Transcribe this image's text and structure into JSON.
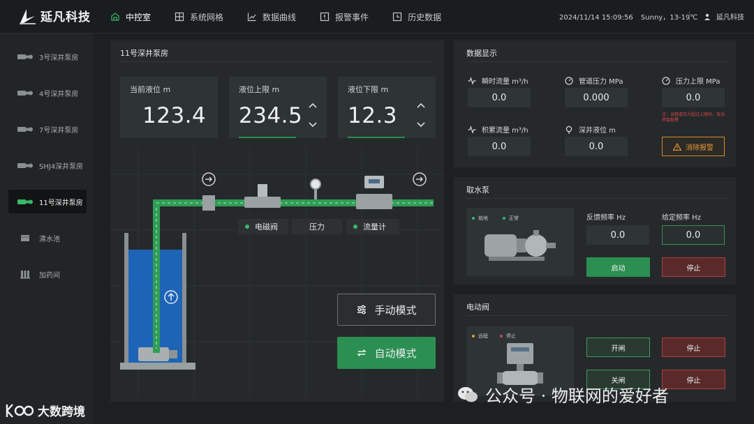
{
  "header": {
    "brand": "延凡科技",
    "nav": [
      {
        "label": "中控室",
        "icon": "home-icon"
      },
      {
        "label": "系统网格",
        "icon": "grid-icon"
      },
      {
        "label": "数据曲线",
        "icon": "chart-icon"
      },
      {
        "label": "报警事件",
        "icon": "alarm-icon"
      },
      {
        "label": "历史数据",
        "icon": "history-icon"
      }
    ],
    "datetime": "2024/11/14 15:09:56",
    "weather": "Sunny，13-19℃",
    "user": "延凡科技"
  },
  "sidebar": {
    "items": [
      {
        "label": "3号深井泵房",
        "icon": "pump-icon"
      },
      {
        "label": "4号深井泵房",
        "icon": "pump-icon"
      },
      {
        "label": "7号深井泵房",
        "icon": "pump-icon"
      },
      {
        "label": "SHJ4深井泵房",
        "icon": "pump-icon"
      },
      {
        "label": "11号深井泵房",
        "icon": "pump-icon",
        "active": true
      },
      {
        "label": "清水池",
        "icon": "pool-icon"
      },
      {
        "label": "加药间",
        "icon": "dosing-icon"
      }
    ]
  },
  "main": {
    "title": "11号深井泵房",
    "cards": [
      {
        "label": "当前液位 m",
        "value": "123.4"
      },
      {
        "label": "液位上限 m",
        "value": "234.5"
      },
      {
        "label": "液位下限 m",
        "value": "12.3"
      }
    ],
    "tags": {
      "valve": "电磁阀",
      "pressure": "压力",
      "flowmeter": "流量计"
    },
    "modes": {
      "manual": "手动模式",
      "auto": "自动模式"
    },
    "colors": {
      "accent": "#2b8f52",
      "water": "#1c6fd0",
      "pipe": "#2f9d55"
    }
  },
  "data_display": {
    "title": "数据显示",
    "fields": [
      {
        "label": "瞬时流量  m³/h",
        "value": "0.0",
        "icon": "pulse-icon"
      },
      {
        "label": "管道压力  MPa",
        "value": "0.000",
        "icon": "gauge-icon"
      },
      {
        "label": "压力上限  MPa",
        "value": "0.0",
        "icon": "gauge-icon"
      },
      {
        "label": "积累流量  m³/h",
        "value": "0.0",
        "icon": "pulse-icon"
      },
      {
        "label": "深井液位  m",
        "value": "0.0",
        "icon": "bulb-icon"
      }
    ],
    "warning_note": "注：当管道压力超过上限时，自动停泵报警",
    "clear_alarm": "消除报警"
  },
  "pump": {
    "title": "取水泵",
    "legend": [
      {
        "label": "就地",
        "color": "#39b86a"
      },
      {
        "label": "正常",
        "color": "#39b86a"
      }
    ],
    "feedback_label": "反馈频率  Hz",
    "feedback_value": "0.0",
    "set_label": "给定频率  Hz",
    "set_value": "0.0",
    "start": "启动",
    "stop": "停止"
  },
  "valve": {
    "title": "电动阀",
    "legend": [
      {
        "label": "远程",
        "color": "#e0a030"
      },
      {
        "label": "停止",
        "color": "#d84848"
      }
    ],
    "open": "开闸",
    "stop1": "停止",
    "close": "关闸",
    "stop2": "停止"
  },
  "overlay": {
    "wechat": "公众号 · 物联网的爱好者",
    "corner": "大数跨境"
  }
}
